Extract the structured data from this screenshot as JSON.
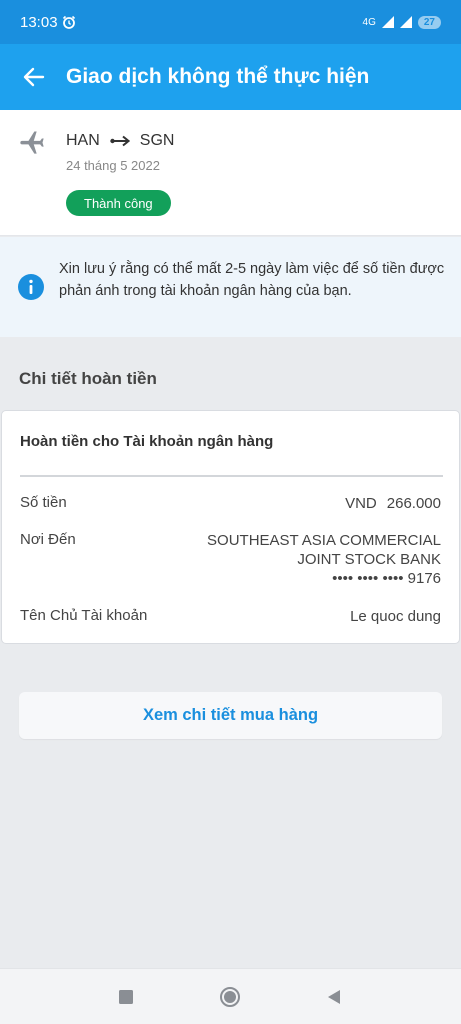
{
  "status_bar": {
    "time": "13:03",
    "network": "4G",
    "battery": "27"
  },
  "app_bar": {
    "title": "Giao dịch không thể thực hiện"
  },
  "flight": {
    "origin": "HAN",
    "destination": "SGN",
    "date": "24 tháng 5 2022",
    "status": "Thành công"
  },
  "notice": {
    "text": "Xin lưu ý rằng có thể mất 2-5 ngày làm việc để số tiền được phản ánh trong tài khoản ngân hàng của bạn."
  },
  "refund": {
    "section_title": "Chi tiết hoàn tiền",
    "card_title": "Hoàn tiền cho Tài khoản ngân hàng",
    "amount_label": "Số tiền",
    "currency": "VND",
    "amount": "266.000",
    "destination_label": "Nơi Đến",
    "bank_line1": "SOUTHEAST ASIA COMMERCIAL",
    "bank_line2": "JOINT STOCK BANK",
    "account_masked": "•••• •••• •••• 9176",
    "holder_label": "Tên Chủ Tài khoản",
    "holder_name": "Le quoc dung"
  },
  "actions": {
    "view_purchase": "Xem chi tiết mua hàng"
  },
  "colors": {
    "primary": "#1ea1ee",
    "status_bar": "#1a8fde",
    "success": "#12a05a",
    "link": "#1a8fde"
  },
  "icons": {
    "back": "arrow-left-icon",
    "plane": "airplane-icon",
    "route": "two-way-arrow-icon",
    "info": "info-icon"
  }
}
